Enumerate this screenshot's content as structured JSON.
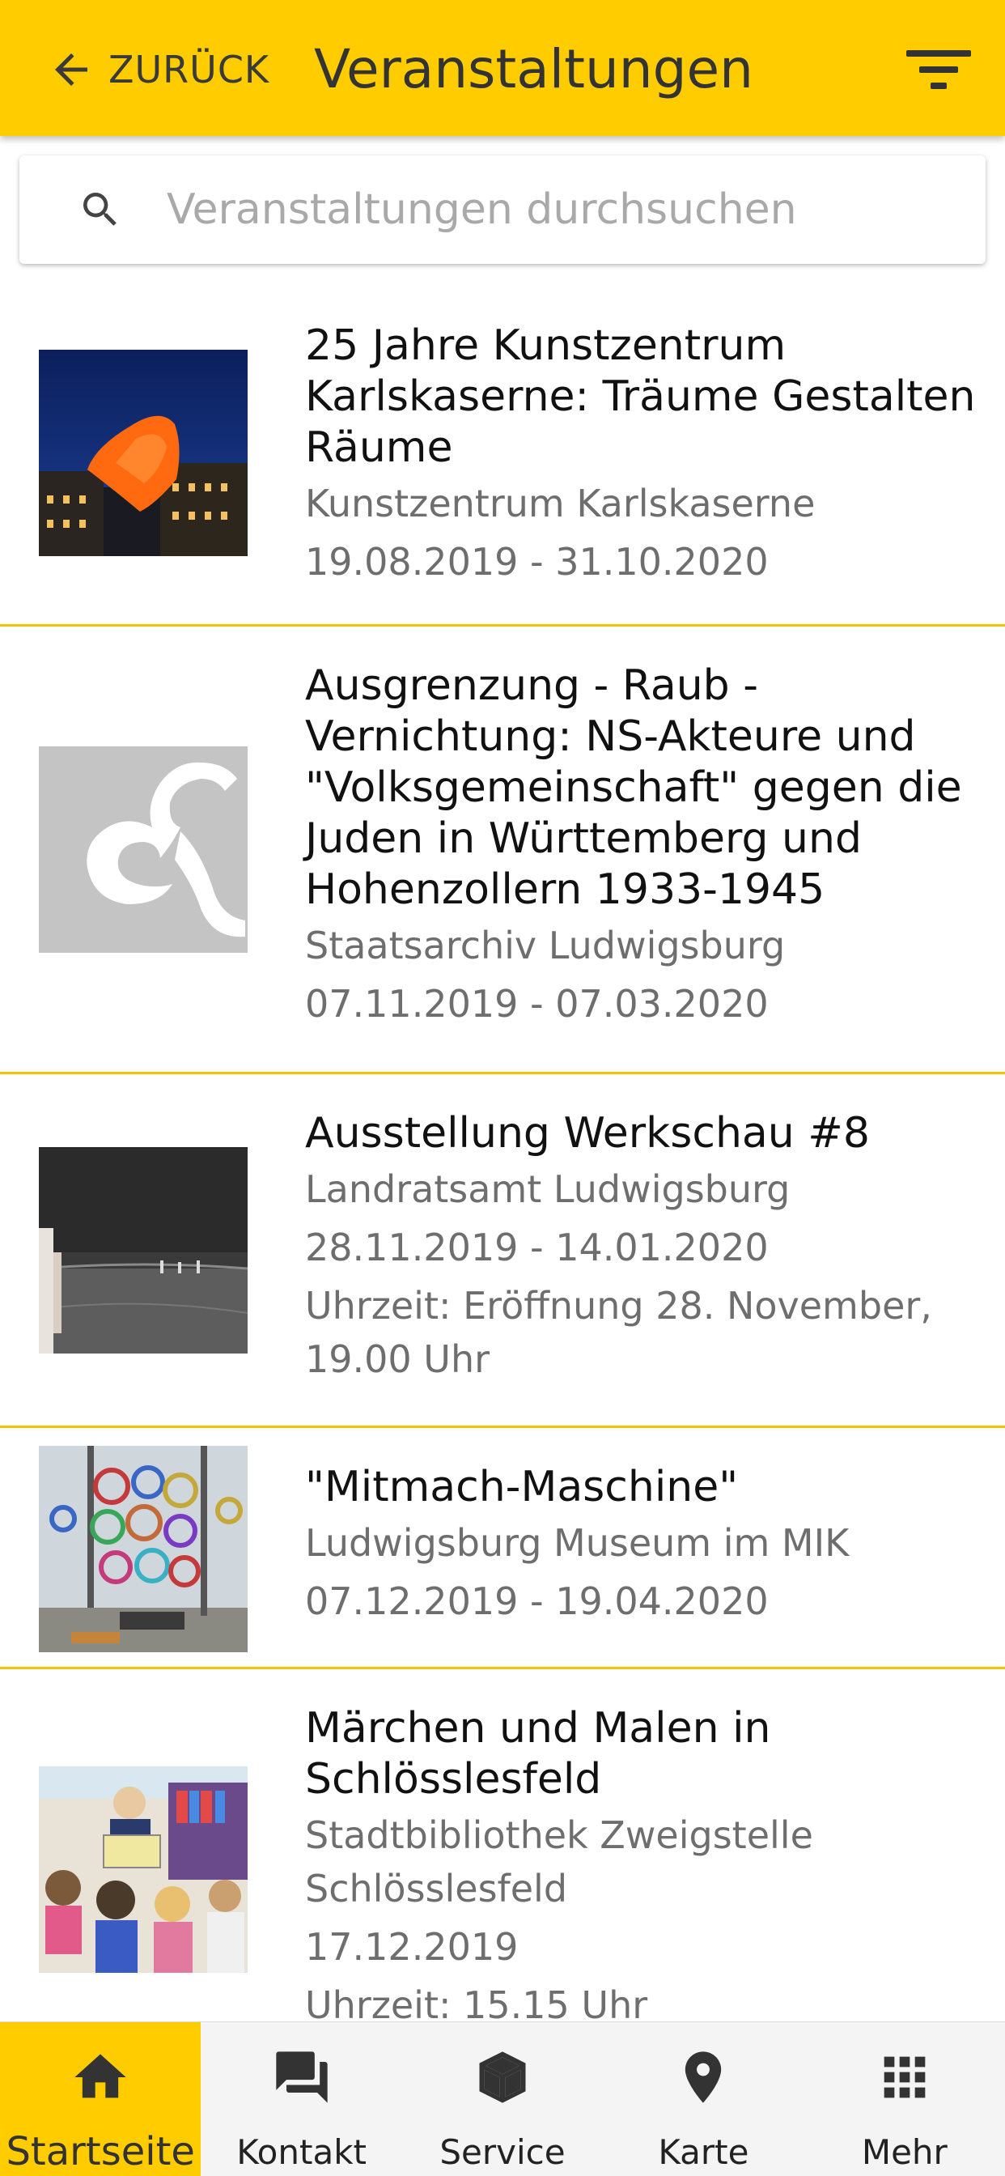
{
  "header": {
    "back_label": "ZURÜCK",
    "title": "Veranstaltungen",
    "filter_icon": "filter-icon"
  },
  "search": {
    "placeholder": "Veranstaltungen durchsuchen",
    "icon": "search-icon"
  },
  "events": [
    {
      "title_lines": [
        "25 Jahre Kunstzentrum",
        "Karlskaserne: Träume Gestalten",
        "Räume"
      ],
      "location": "Kunstzentrum Karlskaserne",
      "date": "19.08.2019 - 31.10.2020"
    },
    {
      "title_lines": [
        "Ausgrenzung - Raub -",
        "Vernichtung: NS-Akteure und",
        "\"Volksgemeinschaft\" gegen die",
        "Juden in Württemberg und",
        "Hohenzollern 1933-1945"
      ],
      "location": "Staatsarchiv Ludwigsburg",
      "date": "07.11.2019 - 07.03.2020"
    },
    {
      "title_lines": [
        "Ausstellung Werkschau #8"
      ],
      "location": "Landratsamt Ludwigsburg",
      "date": "28.11.2019 - 14.01.2020",
      "time_lines": [
        "Uhrzeit: Eröffnung 28. November,",
        "19.00 Uhr"
      ]
    },
    {
      "title_lines": [
        "\"Mitmach-Maschine\""
      ],
      "location": "Ludwigsburg Museum im MIK",
      "date": "07.12.2019 - 19.04.2020"
    },
    {
      "title_lines": [
        "Märchen und Malen in",
        "Schlösslesfeld"
      ],
      "location_lines": [
        "Stadtbibliothek Zweigstelle",
        "Schlösslesfeld"
      ],
      "date": "17.12.2019",
      "time_lines": [
        "Uhrzeit: 15.15 Uhr"
      ]
    }
  ],
  "bottom_nav": [
    {
      "label": "Startseite",
      "icon": "home-icon",
      "active": true
    },
    {
      "label": "Kontakt",
      "icon": "chat-icon",
      "active": false
    },
    {
      "label": "Service",
      "icon": "box-icon",
      "active": false
    },
    {
      "label": "Karte",
      "icon": "map-pin-icon",
      "active": false
    },
    {
      "label": "Mehr",
      "icon": "grid-icon",
      "active": false
    }
  ],
  "colors": {
    "accent": "#FFCC00",
    "divider": "#F2C300",
    "secondary_text": "#6e6e6e"
  }
}
